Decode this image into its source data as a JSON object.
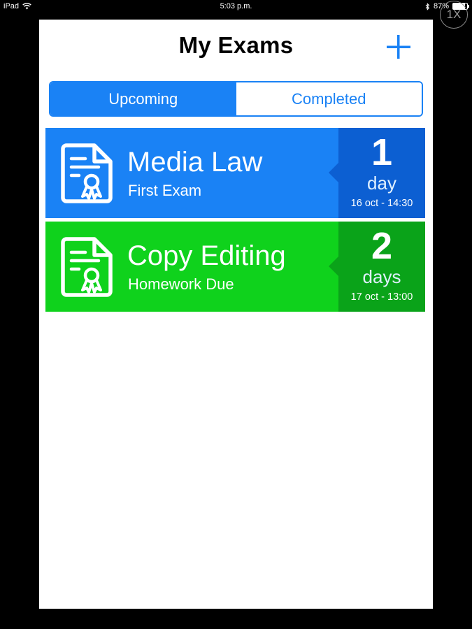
{
  "status_bar": {
    "device": "iPad",
    "time": "5:03 p.m.",
    "battery": "87%",
    "battery_level": 0.87
  },
  "zoom_badge": "1X",
  "nav": {
    "title": "My Exams",
    "add_icon": "plus-icon"
  },
  "tabs": [
    {
      "label": "Upcoming",
      "active": true
    },
    {
      "label": "Completed",
      "active": false
    }
  ],
  "exams": [
    {
      "name": "Media Law",
      "type": "First Exam",
      "count": "1",
      "unit": "day",
      "date": "16 oct - 14:30",
      "icon": "certificate-document-icon",
      "color": "#1a82f5",
      "panel_color": "#0c5fd2"
    },
    {
      "name": "Copy Editing",
      "type": "Homework Due",
      "count": "2",
      "unit": "days",
      "date": "17 oct - 13:00",
      "icon": "certificate-document-icon",
      "color": "#0fd21c",
      "panel_color": "#0aa319"
    }
  ]
}
